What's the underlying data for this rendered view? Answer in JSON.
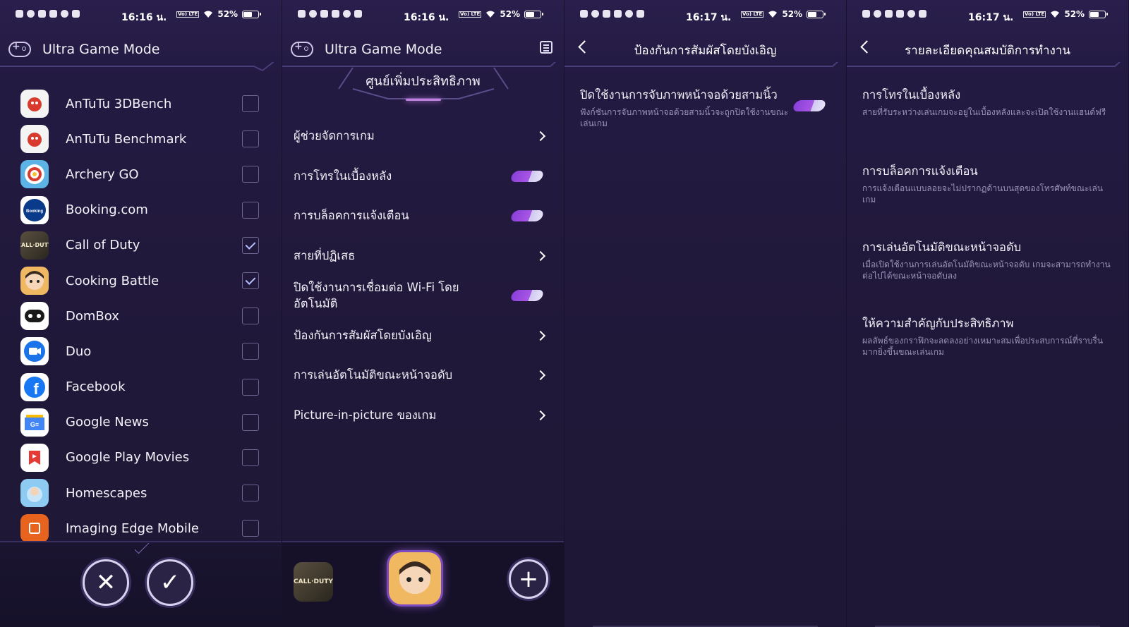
{
  "status": {
    "time_1": "16:16 น.",
    "time_2": "16:16 น.",
    "time_3": "16:17 น.",
    "time_4": "16:17 น.",
    "battery": "52%",
    "volte": "Vo) LTE"
  },
  "screen1": {
    "title": "Ultra Game Mode",
    "apps": [
      {
        "name": "AnTuTu 3DBench",
        "checked": false,
        "color": "#e84a3a"
      },
      {
        "name": "AnTuTu Benchmark",
        "checked": false,
        "color": "#e84a3a"
      },
      {
        "name": "Archery GO",
        "checked": false,
        "color": "#3aa0d8"
      },
      {
        "name": "Booking.com",
        "checked": false,
        "color": "#0a3a8a"
      },
      {
        "name": "Call of Duty",
        "checked": true,
        "color": "#3a3428"
      },
      {
        "name": "Cooking Battle",
        "checked": true,
        "color": "#e8a24a"
      },
      {
        "name": "DomBox",
        "checked": false,
        "color": "#1a1a1a"
      },
      {
        "name": "Duo",
        "checked": false,
        "color": "#1a73e8"
      },
      {
        "name": "Facebook",
        "checked": false,
        "color": "#1877f2"
      },
      {
        "name": "Google News",
        "checked": false,
        "color": "#ffffff"
      },
      {
        "name": "Google Play Movies",
        "checked": false,
        "color": "#ffffff"
      },
      {
        "name": "Homescapes",
        "checked": false,
        "color": "#7ab8e8"
      },
      {
        "name": "Imaging Edge Mobile",
        "checked": false,
        "color": "#e8641e"
      }
    ],
    "cancel_symbol": "✕",
    "confirm_symbol": "✓"
  },
  "screen2": {
    "title": "Ultra Game Mode",
    "section": "ศูนย์เพิ่มประสิทธิภาพ",
    "items": [
      {
        "label": "ผู้ช่วยจัดการเกม",
        "type": "chevron"
      },
      {
        "label": "การโทรในเบื้องหลัง",
        "type": "toggle"
      },
      {
        "label": "การบล็อคการแจ้งเตือน",
        "type": "toggle"
      },
      {
        "label": "สายที่ปฏิเสธ",
        "type": "chevron"
      },
      {
        "label": "ปิดใช้งานการเชื่อมต่อ Wi-Fi โดยอัตโนมัติ",
        "type": "toggle"
      },
      {
        "label": "ป้องกันการสัมผัสโดยบังเอิญ",
        "type": "chevron"
      },
      {
        "label": "การเล่นอัตโนมัติขณะหน้าจอดับ",
        "type": "chevron"
      },
      {
        "label": "Picture-in-picture ของเกม",
        "type": "chevron"
      }
    ],
    "add_symbol": "+",
    "cod_label": "CALL·DUTY"
  },
  "screen3": {
    "title": "ป้องกันการสัมผัสโดยบังเอิญ",
    "setting_title": "ปิดใช้งานการจับภาพหน้าจอด้วยสามนิ้ว",
    "setting_desc": "ฟังก์ชันการจับภาพหน้าจอด้วยสามนิ้วจะถูกปิดใช้งานขณะเล่นเกม"
  },
  "screen4": {
    "title": "รายละเอียดคุณสมบัติการทำงาน",
    "items": [
      {
        "title": "การโทรในเบื้องหลัง",
        "desc": "สายที่รับระหว่างเล่นเกมจะอยู่ในเบื้องหลังและจะเปิดใช้งานแฮนด์ฟรี"
      },
      {
        "title": "การบล็อคการแจ้งเตือน",
        "desc": "การแจ้งเตือนแบบลอยจะไม่ปรากฏด้านบนสุดของโทรศัพท์ขณะเล่นเกม"
      },
      {
        "title": "การเล่นอัตโนมัติขณะหน้าจอดับ",
        "desc": "เมื่อเปิดใช้งานการเล่นอัตโนมัติขณะหน้าจอดับ เกมจะสามารถทำงานต่อไปได้ขณะหน้าจอดับลง"
      },
      {
        "title": "ให้ความสำคัญกับประสิทธิภาพ",
        "desc": "ผลลัพธ์ของกราฟิกจะลดลงอย่างเหมาะสมเพื่อประสบการณ์ที่ราบรื่นมากยิ่งขึ้นขณะเล่นเกม"
      }
    ]
  }
}
